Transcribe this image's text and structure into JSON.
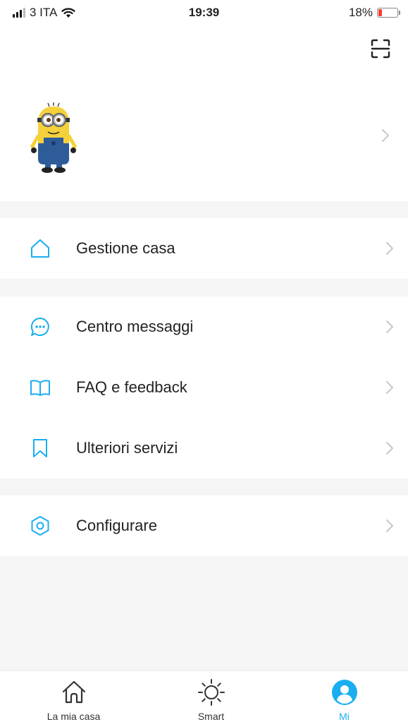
{
  "status_bar": {
    "carrier": "3 ITA",
    "time": "19:39",
    "battery_percent": "18%",
    "battery_level": 0.18,
    "battery_color": "#ff3b30"
  },
  "header": {
    "scan_icon": "scan-icon",
    "avatar_icon": "minion-avatar"
  },
  "menu_sections": [
    {
      "items": [
        {
          "label": "Gestione casa",
          "icon": "home-outline-icon"
        }
      ]
    },
    {
      "items": [
        {
          "label": "Centro messaggi",
          "icon": "chat-bubble-icon"
        },
        {
          "label": "FAQ e feedback",
          "icon": "open-book-icon"
        },
        {
          "label": "Ulteriori servizi",
          "icon": "bookmark-icon"
        }
      ]
    },
    {
      "items": [
        {
          "label": "Configurare",
          "icon": "hexagon-settings-icon"
        }
      ]
    }
  ],
  "tab_bar": {
    "tabs": [
      {
        "label": "La mia casa",
        "icon": "house-icon",
        "active": false
      },
      {
        "label": "Smart",
        "icon": "sun-icon",
        "active": false
      },
      {
        "label": "Mi",
        "icon": "user-profile-icon",
        "active": true
      }
    ]
  },
  "colors": {
    "accent": "#1aaef0",
    "background": "#f5f5f5",
    "chevron": "#c8c8c8"
  }
}
